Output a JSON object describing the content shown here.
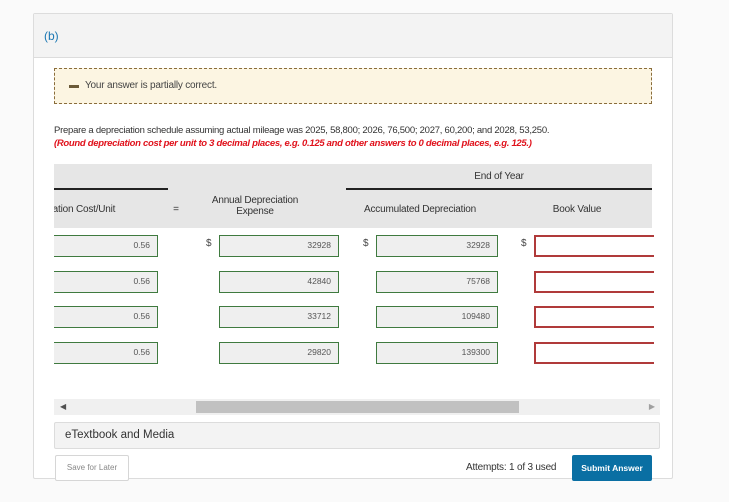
{
  "part_label": "(b)",
  "feedback": {
    "status_icon": "minus-icon",
    "message": "Your answer is partially correct."
  },
  "instructions": {
    "text": "Prepare a depreciation schedule assuming actual mileage was 2025, 58,800; 2026, 76,500; 2027, 60,200; and 2028, 53,250.",
    "rounding_note": "(Round depreciation cost per unit to 3 decimal places, e.g. 0.125 and other answers to 0 decimal places, e.g. 125.)"
  },
  "table": {
    "group_header": "End of Year",
    "headers": {
      "cost_per_unit": "preciation Cost/Unit",
      "equals": "=",
      "annual_expense": "Annual Depreciation Expense",
      "accumulated": "Accumulated Depreciation",
      "book_value": "Book Value"
    },
    "currency_symbol": "$",
    "rows": [
      {
        "cost_per_unit": "0.56",
        "annual_expense": "32928",
        "accumulated": "32928",
        "book_value": "",
        "book_value_status": "incorrect"
      },
      {
        "cost_per_unit": "0.56",
        "annual_expense": "42840",
        "accumulated": "75768",
        "book_value": "",
        "book_value_status": "incorrect"
      },
      {
        "cost_per_unit": "0.56",
        "annual_expense": "33712",
        "accumulated": "109480",
        "book_value": "",
        "book_value_status": "incorrect"
      },
      {
        "cost_per_unit": "0.56",
        "annual_expense": "29820",
        "accumulated": "139300",
        "book_value": "",
        "book_value_status": "incorrect"
      }
    ]
  },
  "scrollbar": {
    "left_arrow": "◀",
    "right_arrow": "▶"
  },
  "etextbook_label": "eTextbook and Media",
  "footer": {
    "save_label": "Save for Later",
    "attempts_text": "Attempts: 1 of 3 used",
    "submit_label": "Submit Answer"
  },
  "colors": {
    "accent": "#0a6fa3",
    "correct_border": "#3f7a3f",
    "incorrect_border": "#b03a3a",
    "warning_bg": "#fcf5e2",
    "note_red": "#e0111b"
  }
}
